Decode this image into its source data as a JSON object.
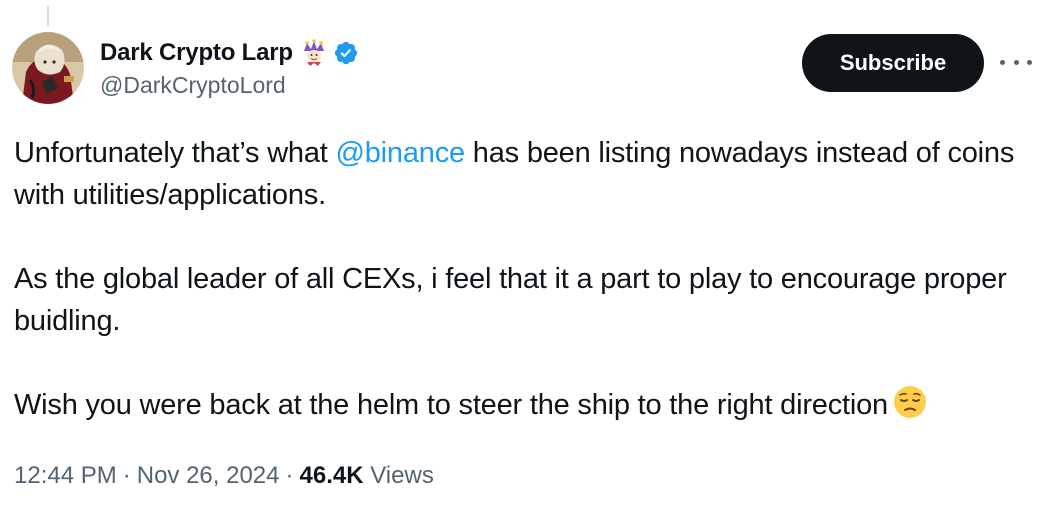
{
  "author": {
    "display_name": "Dark Crypto Larp",
    "handle": "@DarkCryptoLord",
    "badge_icon": "jester-icon",
    "verified_icon": "verified-badge-icon"
  },
  "actions": {
    "subscribe_label": "Subscribe",
    "more_icon": "more-horizontal-icon"
  },
  "tweet": {
    "p1_before": "Unfortunately that’s what ",
    "p1_mention": "@binance",
    "p1_after": " has been listing nowadays instead of coins with utilities/applications.",
    "p2": "As the global leader of all CEXs, i feel that it a part to play to encourage proper buidling.",
    "p3": "Wish you were back at the helm to steer the ship to the right direction",
    "p3_emoji": "pensive-face-emoji"
  },
  "meta": {
    "time": "12:44 PM",
    "separator": "·",
    "date": "Nov 26, 2024",
    "views_count": "46.4K",
    "views_label": "Views"
  },
  "colors": {
    "link": "#1d9bf0",
    "text": "#0f1419",
    "secondary": "#536471",
    "button_bg": "#0f1419",
    "verified": "#1d9bf0"
  }
}
